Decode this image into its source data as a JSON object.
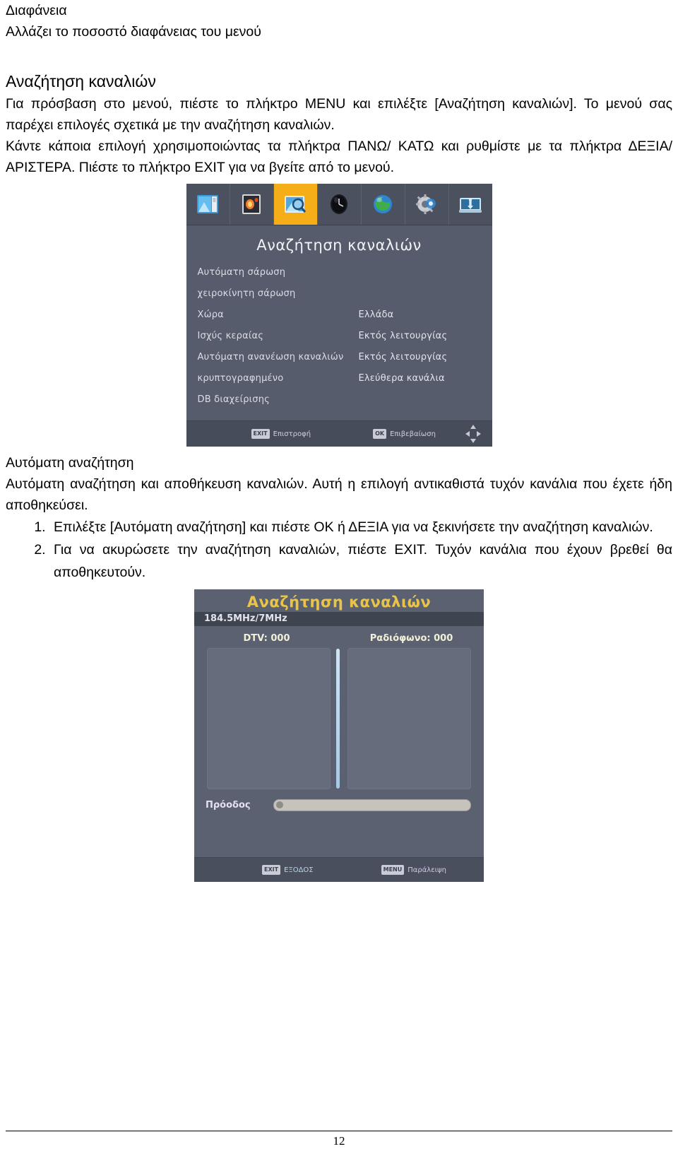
{
  "document": {
    "page_number": "12"
  },
  "section_transparency": {
    "heading": "Διαφάνεια",
    "body": "Αλλάζει το ποσοστό διαφάνειας του μενού"
  },
  "section_channel_search": {
    "heading": "Αναζήτηση  καναλιών",
    "para1": "Για πρόσβαση στο μενού, πιέστε το πλήκτρο MENU και επιλέξτε [Αναζήτηση καναλιών]. Το μενού σας παρέχει επιλογές σχετικά με την αναζήτηση καναλιών.",
    "para2": "Κάντε κάποια επιλογή χρησιμοποιώντας τα πλήκτρα ΠΑΝΩ/ ΚΑΤΩ και ρυθμίστε με τα πλήκτρα ΔΕΞΙΑ/ ΑΡΙΣΤΕΡΑ. Πιέστε το πλήκτρο EXIT για να βγείτε από το μενού."
  },
  "screenshot_menu": {
    "title": "Αναζήτηση καναλιών",
    "icons": [
      {
        "name": "picture-icon",
        "selected": false
      },
      {
        "name": "image-settings-icon",
        "selected": false
      },
      {
        "name": "channel-search-icon",
        "selected": true
      },
      {
        "name": "time-clock-icon",
        "selected": false
      },
      {
        "name": "globe-language-icon",
        "selected": false
      },
      {
        "name": "system-setup-icon",
        "selected": false
      },
      {
        "name": "usb-media-icon",
        "selected": false
      }
    ],
    "rows": [
      {
        "label": "Αυτόματη σάρωση",
        "value": ""
      },
      {
        "label": "χειροκίνητη σάρωση",
        "value": ""
      },
      {
        "label": "Χώρα",
        "value": "Ελλάδα"
      },
      {
        "label": "Ισχύς κεραίας",
        "value": "Εκτός λειτουργίας"
      },
      {
        "label": "Αυτόματη ανανέωση καναλιών",
        "value": "Εκτός λειτουργίας"
      },
      {
        "label": "κρυπτογραφημένο",
        "value": "Ελεύθερα κανάλια"
      },
      {
        "label": "DB διαχείρισης",
        "value": ""
      }
    ],
    "footer": [
      {
        "key": "EXIT",
        "label": "Επιστροφή"
      },
      {
        "key": "OK",
        "label": "Επιβεβαίωση"
      }
    ]
  },
  "section_auto_search": {
    "heading": "Αυτόματη  αναζήτηση",
    "para1": "Αυτόματη αναζήτηση και αποθήκευση καναλιών. Αυτή η επιλογή αντικαθιστά τυχόν κανάλια που έχετε ήδη αποθηκεύσει.",
    "steps": [
      "Επιλέξτε [Αυτόματη αναζήτηση] και πιέστε OK ή ΔΕΞΙΑ για να ξεκινήσετε την αναζήτηση καναλιών.",
      "Για να ακυρώσετε την αναζήτηση καναλιών, πιέστε EXIT. Τυχόν κανάλια που έχουν βρεθεί θα αποθηκευτούν."
    ]
  },
  "screenshot_scanning": {
    "title": "Αναζήτηση καναλιών",
    "frequency": "184.5MHz/7MHz",
    "dtv_count": "DTV: 000",
    "radio_count": "Ραδιόφωνο: 000",
    "progress_label": "Πρόοδος",
    "progress_percent": 2,
    "footer": [
      {
        "key": "EXIT",
        "label": "ΕΞΟΔΟΣ"
      },
      {
        "key": "MENU",
        "label": "Παράλειψη"
      }
    ]
  },
  "colors": {
    "selected_icon": "#f5ae17",
    "scan_title": "#e8c54a",
    "menu_bg": "#565c6b"
  }
}
